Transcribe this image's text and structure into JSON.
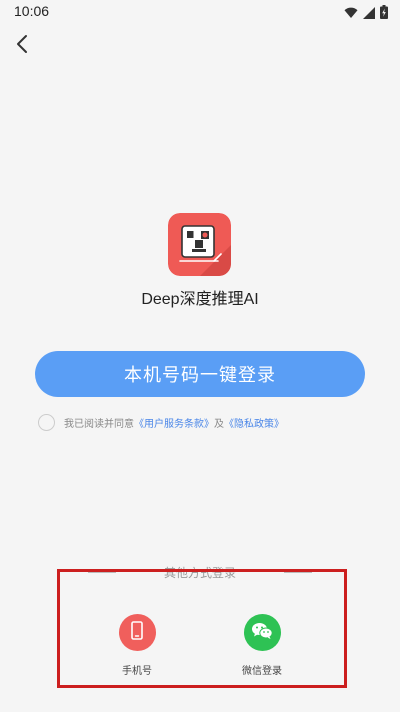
{
  "status_bar": {
    "time": "10:06",
    "icons": [
      "wifi-icon",
      "signal-icon",
      "battery-charging-icon"
    ]
  },
  "header": {
    "back_icon": "chevron-left-icon"
  },
  "app": {
    "icon": "app-logo",
    "name": "Deep深度推理AI"
  },
  "login": {
    "button_label": "本机号码一键登录"
  },
  "agreement": {
    "prefix": "我已阅读并同意",
    "terms_link": "《用户服务条款》",
    "conjunction": "及",
    "privacy_link": "《隐私政策》"
  },
  "other_login": {
    "title": "其他方式登录",
    "methods": [
      {
        "label": "手机号",
        "icon": "phone-icon",
        "color": "#f05f5c"
      },
      {
        "label": "微信登录",
        "icon": "wechat-icon",
        "color": "#2ec254"
      }
    ]
  },
  "colors": {
    "primary": "#5a9ef5",
    "link": "#4a86e8",
    "highlight": "#cc1f1f"
  }
}
